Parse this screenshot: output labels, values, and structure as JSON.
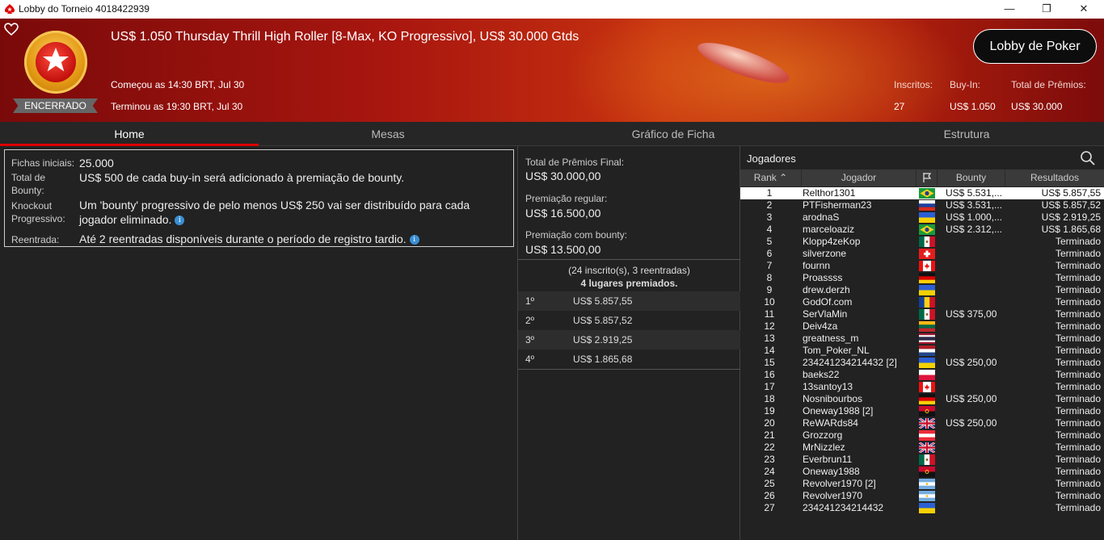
{
  "window": {
    "title": "Lobby do Torneio 4018422939"
  },
  "header": {
    "title": "US$ 1.050 Thursday Thrill High Roller [8-Max, KO Progressivo], US$ 30.000 Gtds",
    "status": "ENCERRADO",
    "started": "Começou as 14:30 BRT, Jul 30",
    "ended": "Terminou as 19:30 BRT, Jul 30",
    "lobby_button": "Lobby de Poker",
    "stats": {
      "entrants_label": "Inscritos:",
      "entrants_value": "27",
      "buyin_label": "Buy-In:",
      "buyin_value": "US$ 1.050",
      "prize_label": "Total de Prêmios:",
      "prize_value": "US$ 30.000"
    }
  },
  "tabs": [
    "Home",
    "Mesas",
    "Gráfico de Ficha",
    "Estrutura"
  ],
  "info": {
    "chips_label": "Fichas iniciais:",
    "chips_value": "25.000",
    "bounty_label": "Total de Bounty:",
    "bounty_value": "US$ 500 de cada buy-in será adicionado à premiação de bounty.",
    "ko_label": "Knockout Progressivo:",
    "ko_value": "Um 'bounty' progressivo de pelo menos US$ 250 vai ser distribuído para cada jogador eliminado.",
    "reentry_label": "Reentrada:",
    "reentry_value": "Até 2 reentradas disponíveis durante o período de registro tardio."
  },
  "prizes": {
    "final_label": "Total de Prêmios Final:",
    "final_value": "US$ 30.000,00",
    "regular_label": "Premiação regular:",
    "regular_value": "US$ 16.500,00",
    "bounty_label": "Premiação com bounty:",
    "bounty_value": "US$ 13.500,00",
    "entries": "(24 inscrito(s), 3 reentradas)",
    "paid": "4 lugares premiados.",
    "places": [
      {
        "pos": "1º",
        "amount": "US$ 5.857,55"
      },
      {
        "pos": "2º",
        "amount": "US$ 5.857,52"
      },
      {
        "pos": "3º",
        "amount": "US$ 2.919,25"
      },
      {
        "pos": "4º",
        "amount": "US$ 1.865,68"
      }
    ]
  },
  "players": {
    "heading": "Jogadores",
    "columns": {
      "rank": "Rank",
      "name": "Jogador",
      "bounty": "Bounty",
      "results": "Resultados"
    },
    "rows": [
      {
        "rank": "1",
        "name": "Relthor1301",
        "flag": "br",
        "bounty": "US$ 5.531,...",
        "result": "US$ 5.857,55"
      },
      {
        "rank": "2",
        "name": "PTFisherman23",
        "flag": "ru",
        "bounty": "US$ 3.531,...",
        "result": "US$ 5.857,52"
      },
      {
        "rank": "3",
        "name": "arodnaS",
        "flag": "ua",
        "bounty": "US$ 1.000,...",
        "result": "US$ 2.919,25"
      },
      {
        "rank": "4",
        "name": "marceloaziz",
        "flag": "br",
        "bounty": "US$ 2.312,...",
        "result": "US$ 1.865,68"
      },
      {
        "rank": "5",
        "name": "Klopp4zeKop",
        "flag": "mx",
        "bounty": "",
        "result": "Terminado"
      },
      {
        "rank": "6",
        "name": "silverzone",
        "flag": "ch",
        "bounty": "",
        "result": "Terminado"
      },
      {
        "rank": "7",
        "name": "fournn",
        "flag": "ca",
        "bounty": "",
        "result": "Terminado"
      },
      {
        "rank": "8",
        "name": "Proassss",
        "flag": "de",
        "bounty": "",
        "result": "Terminado"
      },
      {
        "rank": "9",
        "name": "drew.derzh",
        "flag": "ua",
        "bounty": "",
        "result": "Terminado"
      },
      {
        "rank": "10",
        "name": "GodOf.com",
        "flag": "ro",
        "bounty": "",
        "result": "Terminado"
      },
      {
        "rank": "11",
        "name": "SerVlaMin",
        "flag": "mx",
        "bounty": "US$ 375,00",
        "result": "Terminado"
      },
      {
        "rank": "12",
        "name": "Deiv4za",
        "flag": "lt",
        "bounty": "",
        "result": "Terminado"
      },
      {
        "rank": "13",
        "name": "greatness_m",
        "flag": "th",
        "bounty": "",
        "result": "Terminado"
      },
      {
        "rank": "14",
        "name": "Tom_Poker_NL",
        "flag": "nl",
        "bounty": "",
        "result": "Terminado"
      },
      {
        "rank": "15",
        "name": "234241234214432 [2]",
        "flag": "ua",
        "bounty": "US$ 250,00",
        "result": "Terminado"
      },
      {
        "rank": "16",
        "name": "baeks22",
        "flag": "pl",
        "bounty": "",
        "result": "Terminado"
      },
      {
        "rank": "17",
        "name": "13santoy13",
        "flag": "ca",
        "bounty": "",
        "result": "Terminado"
      },
      {
        "rank": "18",
        "name": "Nosnibourbos",
        "flag": "de",
        "bounty": "US$ 250,00",
        "result": "Terminado"
      },
      {
        "rank": "19",
        "name": "Oneway1988 [2]",
        "flag": "ao",
        "bounty": "",
        "result": "Terminado"
      },
      {
        "rank": "20",
        "name": "ReWARds84",
        "flag": "gb",
        "bounty": "US$ 250,00",
        "result": "Terminado"
      },
      {
        "rank": "21",
        "name": "Grozzorg",
        "flag": "at",
        "bounty": "",
        "result": "Terminado"
      },
      {
        "rank": "22",
        "name": "MrNizzlez",
        "flag": "gb",
        "bounty": "",
        "result": "Terminado"
      },
      {
        "rank": "23",
        "name": "Everbrun11",
        "flag": "mx",
        "bounty": "",
        "result": "Terminado"
      },
      {
        "rank": "24",
        "name": "Oneway1988",
        "flag": "ao",
        "bounty": "",
        "result": "Terminado"
      },
      {
        "rank": "25",
        "name": "Revolver1970 [2]",
        "flag": "ar",
        "bounty": "",
        "result": "Terminado"
      },
      {
        "rank": "26",
        "name": "Revolver1970",
        "flag": "ar",
        "bounty": "",
        "result": "Terminado"
      },
      {
        "rank": "27",
        "name": "234241234214432",
        "flag": "ua",
        "bounty": "",
        "result": "Terminado"
      }
    ]
  },
  "colors": {
    "accent": "#d00000",
    "header_red": "#a8160f",
    "selected_row": "#ffffff"
  }
}
